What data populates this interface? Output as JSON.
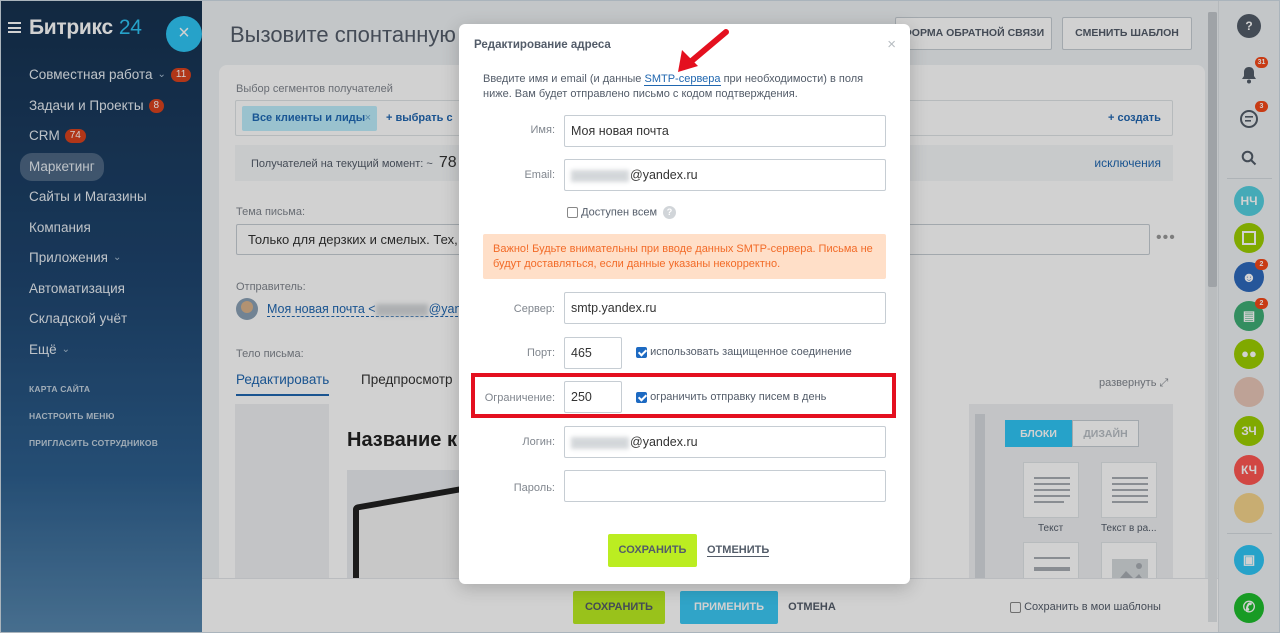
{
  "sidebar": {
    "logo_main": "Битрикс",
    "logo_num": "24",
    "items": [
      {
        "label": "Совместная работа",
        "badge": "11",
        "chev": "⌄"
      },
      {
        "label": "Задачи и Проекты",
        "badge": "8"
      },
      {
        "label": "CRM",
        "badge": "74"
      },
      {
        "label": "Маркетинг"
      },
      {
        "label": "Сайты и Магазины"
      },
      {
        "label": "Компания"
      },
      {
        "label": "Приложения",
        "chev": "⌄"
      },
      {
        "label": "Автоматизация"
      },
      {
        "label": "Складской учёт"
      },
      {
        "label": "Ещё",
        "chev": "⌄"
      }
    ],
    "small": [
      "КАРТА САЙТА",
      "НАСТРОИТЬ МЕНЮ",
      "ПРИГЛАСИТЬ СОТРУДНИКОВ"
    ],
    "close_symbol": "×"
  },
  "header": {
    "title": "Вызовите спонтанную п",
    "btn_feedback": "ФОРМА ОБРАТНОЙ СВЯЗИ",
    "btn_template": "СМЕНИТЬ ШАБЛОН"
  },
  "form": {
    "segments_label": "Выбор сегментов получателей",
    "segment_chip": "Все клиенты и лиды",
    "chip_x": "×",
    "select_link": "+ выбрать с",
    "create_link": "+ создать",
    "recipients_label": "Получателей на текущий момент: ~",
    "recipients_count": "78",
    "exclusions": "исключения",
    "subject_label": "Тема письма:",
    "subject_value": "Только для дерзких и смелых. Тех, к",
    "dots": "•••",
    "sender_label": "Отправитель:",
    "sender_value": "Моя новая почта <",
    "sender_tail": "@yand",
    "body_label": "Тело письма:",
    "tab_edit": "Редактировать",
    "tab_preview": "Предпросмотр",
    "expand": "развернуть",
    "editor_title": "Название к",
    "blocks_tab": "БЛОКИ",
    "design_tab": "ДИЗАЙН",
    "block_text": "Текст",
    "block_text_img": "Текст в ра..."
  },
  "bottom": {
    "save": "СОХРАНИТЬ",
    "apply": "ПРИМЕНИТЬ",
    "cancel": "ОТМЕНА",
    "save_template": "Сохранить в мои шаблоны"
  },
  "right": {
    "help": "?",
    "bell_badge": "31",
    "chat_badge": "3",
    "avatars": [
      {
        "initials": "НЧ",
        "color": "#55d0e0"
      },
      {
        "initials": "ЗЧ",
        "color": "#9dcf00"
      },
      {
        "initials": "КЧ",
        "color": "#ff5752"
      }
    ],
    "badge_2a": "2",
    "badge_2b": "2"
  },
  "modal": {
    "title": "Редактирование адреса",
    "close": "×",
    "desc_before": "Введите имя и email (и данные ",
    "desc_link": "SMTP-сервера",
    "desc_after": " при необходимости) в поля ниже. Вам будет отправлено письмо с кодом подтверждения.",
    "name_label": "Имя:",
    "name_value": "Моя новая почта",
    "email_label": "Email:",
    "email_domain": "@yandex.ru",
    "public_label": "Доступен всем",
    "help": "?",
    "warning": "Важно! Будьте внимательны при вводе данных SMTP-сервера. Письма не будут доставляться, если данные указаны некорректно.",
    "server_label": "Сервер:",
    "server_value": "smtp.yandex.ru",
    "port_label": "Порт:",
    "port_value": "465",
    "secure_label": "использовать защищенное соединение",
    "limit_label": "Ограничение:",
    "limit_value": "250",
    "limit_check_label": "ограничить отправку писем в день",
    "login_label": "Логин:",
    "login_domain": "@yandex.ru",
    "password_label": "Пароль:",
    "save": "СОХРАНИТЬ",
    "cancel": "ОТМЕНИТЬ"
  },
  "colors": {
    "accent_blue": "#2fc6f6",
    "accent_green": "#bbed21",
    "highlight_red": "#e4101f",
    "warning_bg": "#ffdfc8"
  }
}
